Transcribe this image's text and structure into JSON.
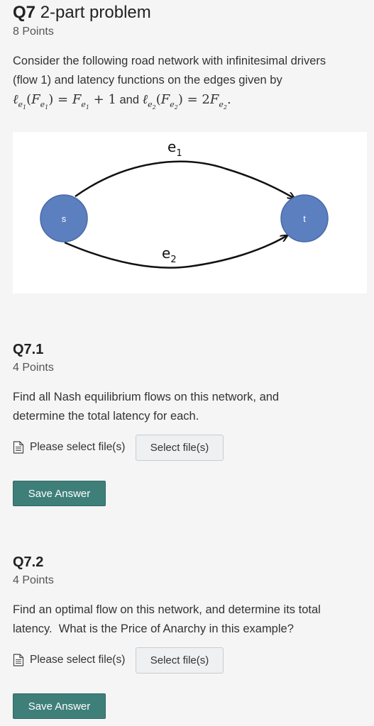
{
  "question": {
    "number": "Q7",
    "title": "2-part problem",
    "points": "8 Points",
    "intro_line1": "Consider the following road network with infinitesimal drivers",
    "intro_line2": "(flow 1) and latency functions on the edges given by",
    "and_word": "and"
  },
  "diagram": {
    "node_s": "s",
    "node_t": "t",
    "edge1": "e",
    "edge1_sub": "1",
    "edge2": "e",
    "edge2_sub": "2",
    "node_color": "#5b7fbf"
  },
  "subquestions": [
    {
      "number": "Q7.1",
      "points": "4 Points",
      "line1": "Find all Nash equilibrium flows on this network, and",
      "line2": "determine the total latency for each.",
      "file_label": "Please select file(s)",
      "select_button": "Select file(s)",
      "save_button": "Save Answer"
    },
    {
      "number": "Q7.2",
      "points": "4 Points",
      "line1": "Find an optimal flow on this network, and determine its total",
      "line2": "latency.  What is the Price of Anarchy in this example?",
      "file_label": "Please select file(s)",
      "select_button": "Select file(s)",
      "save_button": "Save Answer"
    }
  ]
}
